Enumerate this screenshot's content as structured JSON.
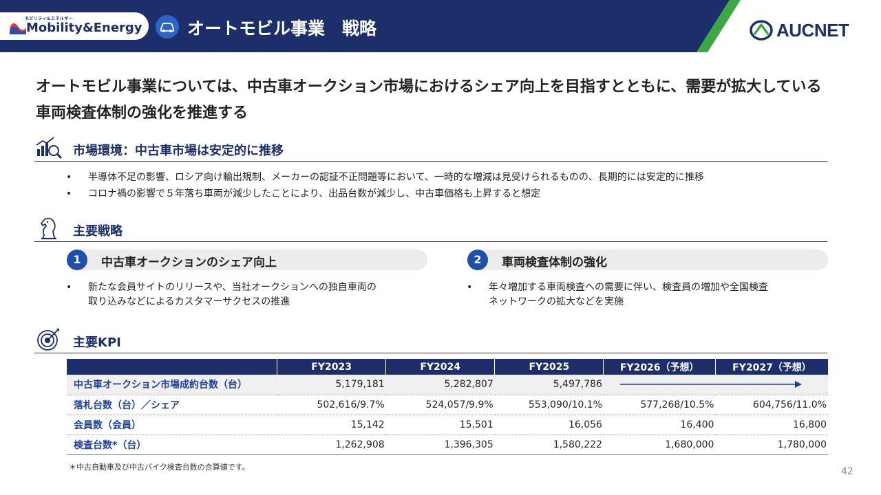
{
  "header": {
    "brand_small": "モビリティ&エネルギー",
    "brand_main": "Mobility&Energy",
    "title": "オートモビル事業　戦略",
    "logo_text": "AUCNET",
    "band_color": "#1c2f6b",
    "accent_color": "#3aa845"
  },
  "lead": {
    "text": "オートモビル事業については、中古車オークション市場におけるシェア向上を目指すとともに、需要が拡大している車両検査体制の強化を推進する"
  },
  "market": {
    "icon": "market-chart-magnifier-icon",
    "title": "市場環境：中古車市場は安定的に推移",
    "bullets": [
      "半導体不足の影響、ロシア向け輸出規制、メーカーの認証不正問題等において、一時的な増減は見受けられるものの、長期的には安定的に推移",
      "コロナ禍の影響で５年落ち車両が減少したことにより、出品台数が減少し、中古車価格も上昇すると想定"
    ]
  },
  "strategy": {
    "icon": "chess-knight-icon",
    "title": "主要戦略",
    "items": [
      {
        "number": "1",
        "label": "中古車オークションのシェア向上",
        "desc_line1": "新たな会員サイトのリリースや、当社オークションへの独自車両の",
        "desc_line2": "取り込みなどによるカスタマーサクセスの推進"
      },
      {
        "number": "2",
        "label": "車両検査体制の強化",
        "desc_line1": "年々増加する車両検査への需要に伴い、検査員の増加や全国検査",
        "desc_line2": "ネットワークの拡大などを実施"
      }
    ]
  },
  "kpi": {
    "icon": "target-arrow-icon",
    "title": "主要KPI",
    "columns": [
      "FY2023",
      "FY2024",
      "FY2025",
      "FY2026（予想）",
      "FY2027（予想）"
    ],
    "rows": [
      {
        "label": "中古車オークション市場成約台数（台）",
        "values": [
          "5,179,181",
          "5,282,807",
          "5,497,786",
          "",
          ""
        ]
      },
      {
        "label": "落札台数（台）／シェア",
        "values": [
          "502,616/9.7%",
          "524,057/9.9%",
          "553,090/10.1%",
          "577,268/10.5%",
          "604,756/11.0%"
        ]
      },
      {
        "label": "会員数（会員）",
        "values": [
          "15,142",
          "15,501",
          "16,056",
          "16,400",
          "16,800"
        ]
      },
      {
        "label": "検査台数*（台）",
        "values": [
          "1,262,908",
          "1,396,305",
          "1,580,222",
          "1,680,000",
          "1,780,000"
        ]
      }
    ]
  },
  "footnote": "＊中古自動車及び中古バイク検査台数の合算値です。",
  "page_number": "42"
}
